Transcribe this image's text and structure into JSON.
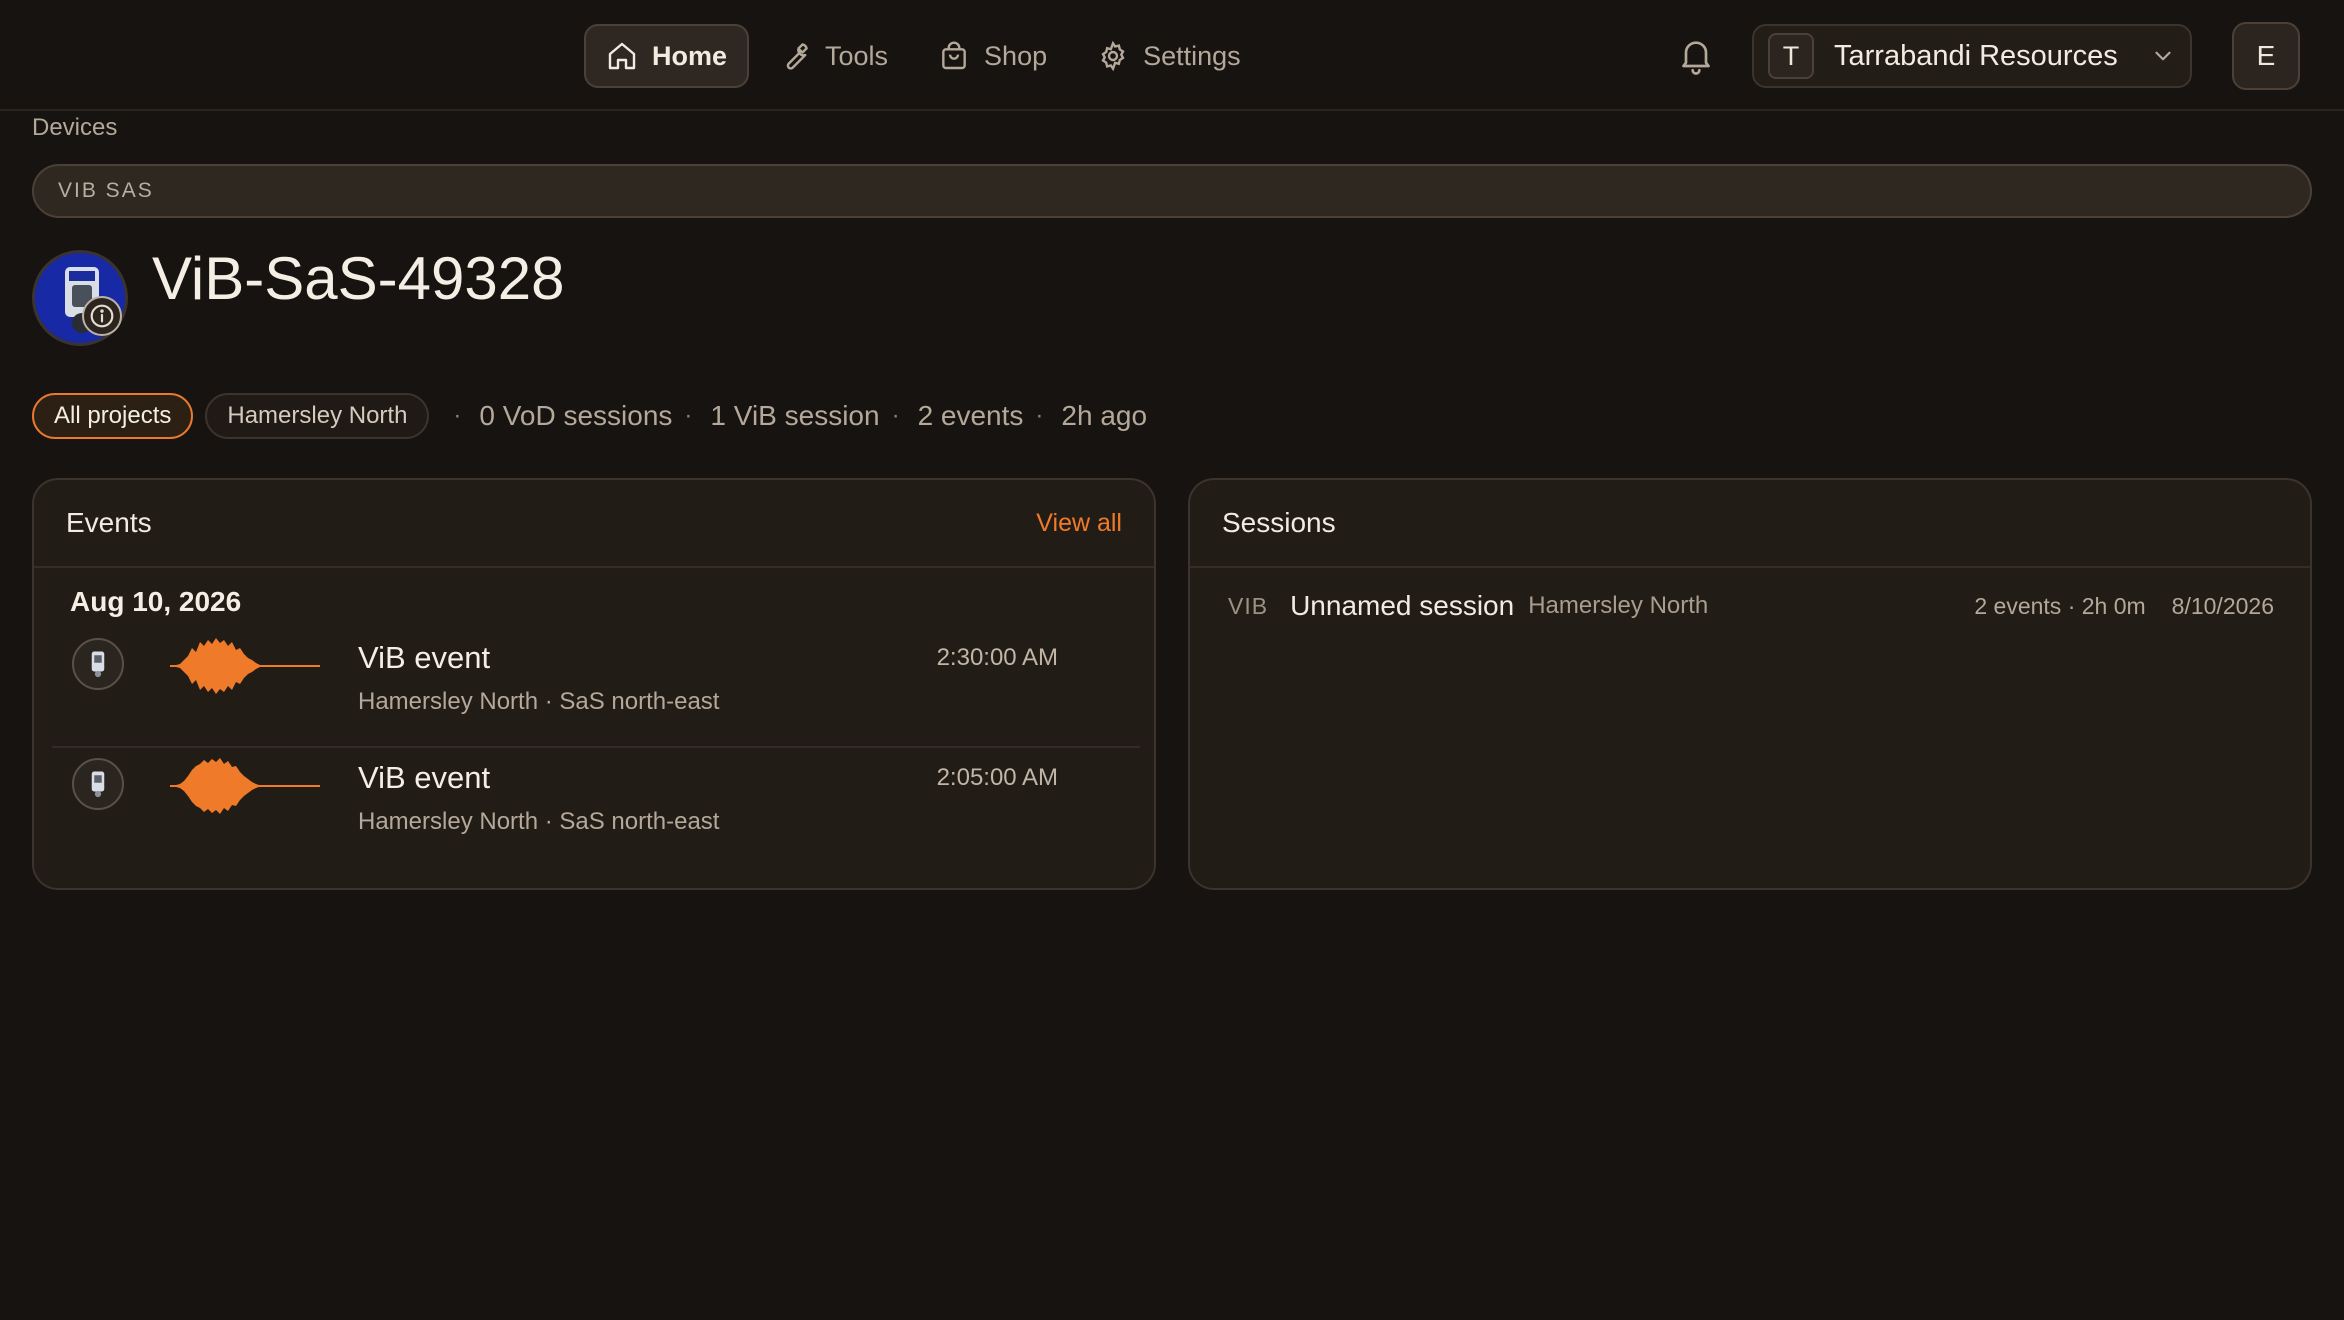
{
  "nav": {
    "items": [
      {
        "label": "Home",
        "icon": "home-icon",
        "active": true
      },
      {
        "label": "Tools",
        "icon": "wrench-icon",
        "active": false
      },
      {
        "label": "Shop",
        "icon": "bag-icon",
        "active": false
      },
      {
        "label": "Settings",
        "icon": "gear-icon",
        "active": false
      }
    ],
    "org": {
      "initial": "T",
      "name": "Tarrabandi Resources"
    },
    "user_initial": "E"
  },
  "breadcrumb": "Devices",
  "device": {
    "type": "VIB SAS",
    "name": "ViB-SaS-49328"
  },
  "filters": {
    "all_projects": "All projects",
    "project": "Hamersley North"
  },
  "stats": {
    "vod": "0 VoD sessions",
    "vib": "1 ViB session",
    "events": "2 events",
    "last_seen": "2h ago"
  },
  "events_card": {
    "title": "Events",
    "view_all": "View all",
    "date": "Aug 10, 2026",
    "items": [
      {
        "title": "ViB event",
        "subtitle": "Hamersley North · SaS north-east",
        "time": "2:30:00 AM"
      },
      {
        "title": "ViB event",
        "subtitle": "Hamersley North · SaS north-east",
        "time": "2:05:00 AM"
      }
    ]
  },
  "sessions_card": {
    "title": "Sessions",
    "items": [
      {
        "kind": "VIB",
        "name": "Unnamed session",
        "project": "Hamersley North",
        "meta": "2 events · 2h 0m",
        "date": "8/10/2026"
      }
    ]
  },
  "colors": {
    "accent": "#ef7a2a",
    "background": "#171310",
    "card": "#221c17"
  }
}
